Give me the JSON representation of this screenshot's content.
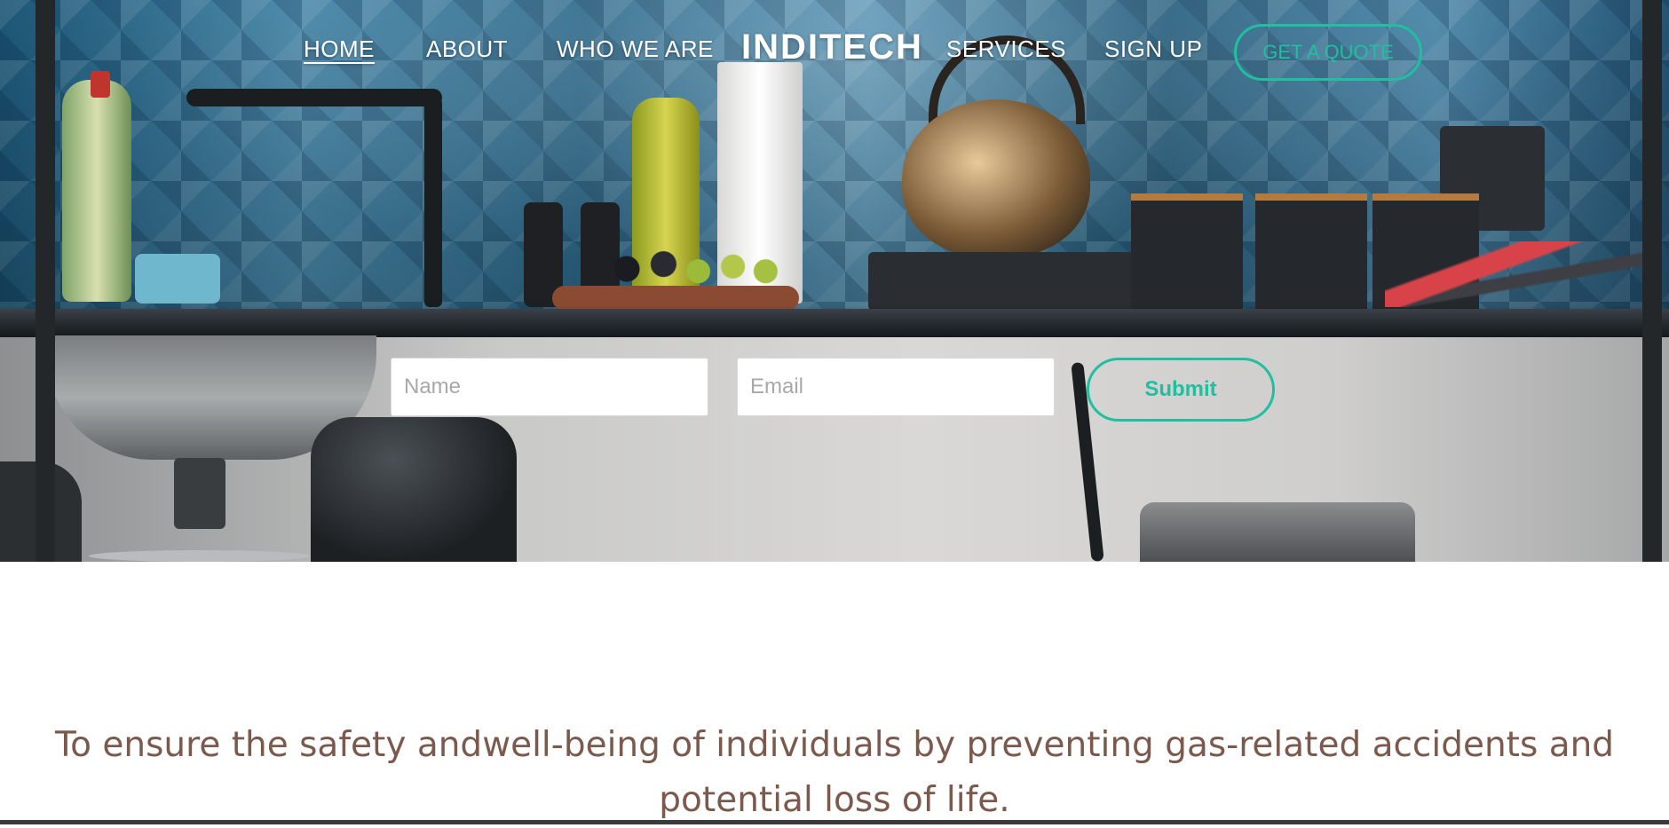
{
  "nav": {
    "links": [
      {
        "label": "HOME",
        "active": true
      },
      {
        "label": "ABOUT",
        "active": false
      },
      {
        "label": "WHO WE ARE",
        "active": false
      },
      {
        "label": "SERVICES",
        "active": false
      },
      {
        "label": "SIGN UP",
        "active": false
      }
    ],
    "logo": "INDITECH",
    "cta_label": "GET A QUOTE"
  },
  "hero": {
    "background": "kitchen-counter-photo",
    "form": {
      "name_placeholder": "Name",
      "email_placeholder": "Email",
      "name_value": "",
      "email_value": "",
      "submit_label": "Submit"
    }
  },
  "mission": {
    "text": "To ensure the safety andwell-being of individuals by preventing gas-related accidents and potential loss of life."
  },
  "colors": {
    "accent": "#1fbfa0",
    "nav_text": "#ffffff",
    "mission_text": "#7b5a4d"
  }
}
